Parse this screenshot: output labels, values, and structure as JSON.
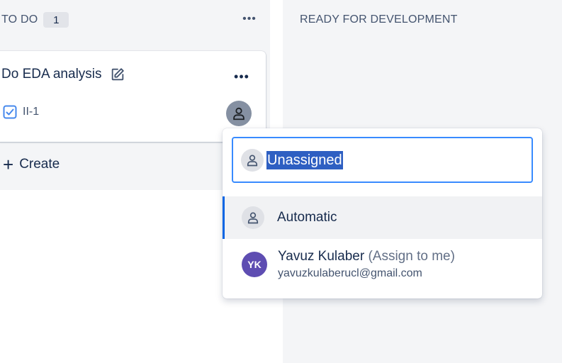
{
  "columns": {
    "todo": {
      "title": "TO DO",
      "count": "1",
      "more": "•••"
    },
    "ready": {
      "title": "READY FOR DEVELOPMENT"
    }
  },
  "card": {
    "title": "Do EDA analysis",
    "key": "II-1",
    "more": "•••"
  },
  "create": {
    "plus": "+",
    "label": "Create"
  },
  "assignee_dropdown": {
    "search_value": "Unassigned",
    "options": [
      {
        "label": "Automatic",
        "highlighted": true
      },
      {
        "name": "Yavuz Kulaber",
        "hint": "(Assign to me)",
        "email": "yavuzkulaberucl@gmail.com",
        "initials": "YK"
      }
    ]
  },
  "colors": {
    "column_bg": "#f4f5f7",
    "focus_border": "#388bff",
    "selection_bg": "#2e5fc2",
    "avatar_yk": "#5e4db2",
    "highlight_bar": "#0c66e4"
  },
  "icons": [
    "edit-icon",
    "task-checkbox-icon",
    "person-icon",
    "more-icon",
    "plus-icon"
  ]
}
